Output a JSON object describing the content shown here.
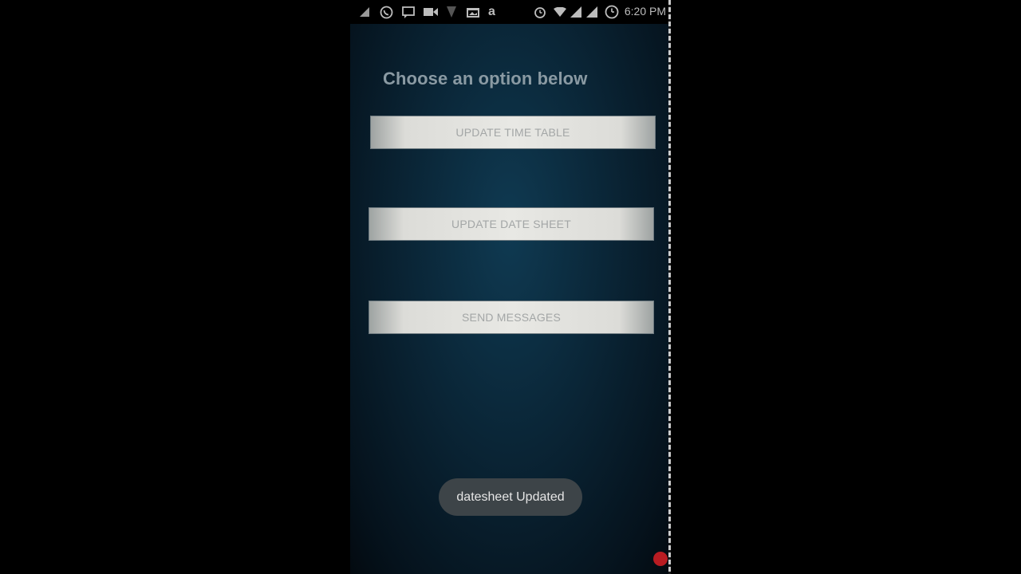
{
  "status_bar": {
    "time": "6:20 PM",
    "left_icons": [
      "signal-small-icon",
      "whatsapp-icon",
      "message-icon",
      "video-icon",
      "signal-off-icon",
      "photo-icon",
      "amazon-icon"
    ],
    "right_icons": [
      "alarm-icon",
      "wifi-icon",
      "signal-bars-icon",
      "signal-bars-icon",
      "clock-icon"
    ]
  },
  "main": {
    "title": "Choose an option below",
    "buttons": [
      {
        "label": "UPDATE TIME TABLE"
      },
      {
        "label": "UPDATE DATE SHEET"
      },
      {
        "label": "SEND MESSAGES"
      }
    ]
  },
  "toast": {
    "message": "datesheet Updated"
  },
  "colors": {
    "background_center": "#0f3a52",
    "background_edge": "#030a10",
    "title": "#8a9aa3",
    "button_face": "#e8e8e4",
    "button_text": "#a3a6a6",
    "toast_bg": "#3d4448",
    "recording_dot": "#b81c22"
  }
}
